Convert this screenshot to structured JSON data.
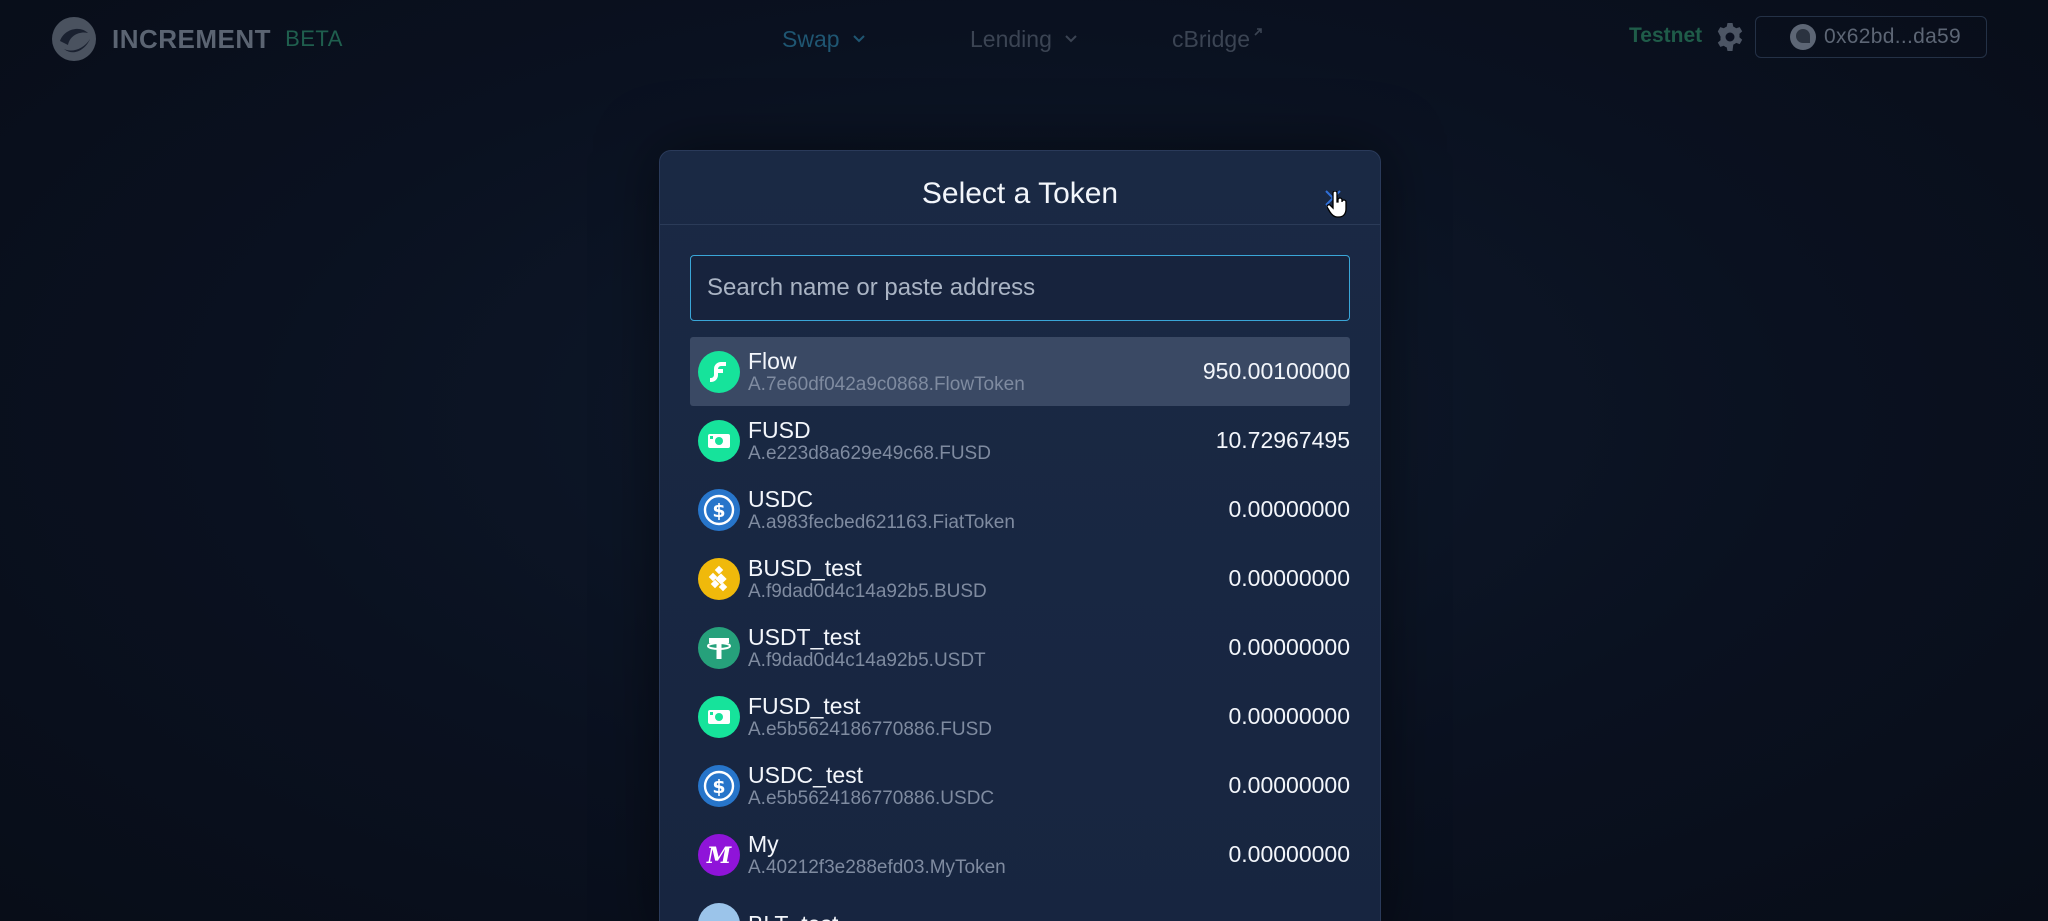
{
  "nav": {
    "brand": "INCREMENT",
    "beta": "BETA",
    "items": [
      {
        "label": "Swap"
      },
      {
        "label": "Lending"
      },
      {
        "label": "cBridge"
      }
    ],
    "network": "Testnet",
    "wallet_address": "0x62bd...da59"
  },
  "modal": {
    "title": "Select a Token",
    "search_placeholder": "Search name or paste address",
    "tokens": [
      {
        "symbol": "Flow",
        "address": "A.7e60df042a9c0868.FlowToken",
        "balance": "950.00100000",
        "icon": "flow-icon",
        "color": "#16e39b"
      },
      {
        "symbol": "FUSD",
        "address": "A.e223d8a629e49c68.FUSD",
        "balance": "10.72967495",
        "icon": "fusd-icon",
        "color": "#16e39b"
      },
      {
        "symbol": "USDC",
        "address": "A.a983fecbed621163.FiatToken",
        "balance": "0.00000000",
        "icon": "usdc-icon",
        "color": "#2775ca"
      },
      {
        "symbol": "BUSD_test",
        "address": "A.f9dad0d4c14a92b5.BUSD",
        "balance": "0.00000000",
        "icon": "busd-icon",
        "color": "#f0b90b"
      },
      {
        "symbol": "USDT_test",
        "address": "A.f9dad0d4c14a92b5.USDT",
        "balance": "0.00000000",
        "icon": "usdt-icon",
        "color": "#26a17b"
      },
      {
        "symbol": "FUSD_test",
        "address": "A.e5b5624186770886.FUSD",
        "balance": "0.00000000",
        "icon": "fusd-icon",
        "color": "#16e39b"
      },
      {
        "symbol": "USDC_test",
        "address": "A.e5b5624186770886.USDC",
        "balance": "0.00000000",
        "icon": "usdc-icon",
        "color": "#2775ca"
      },
      {
        "symbol": "My",
        "address": "A.40212f3e288efd03.MyToken",
        "balance": "0.00000000",
        "icon": "my-token-icon",
        "color": "#8f14d9"
      },
      {
        "symbol": "BLT_test",
        "address": "",
        "balance": "",
        "icon": "blt-icon",
        "color": "#9bc4ea"
      }
    ]
  }
}
